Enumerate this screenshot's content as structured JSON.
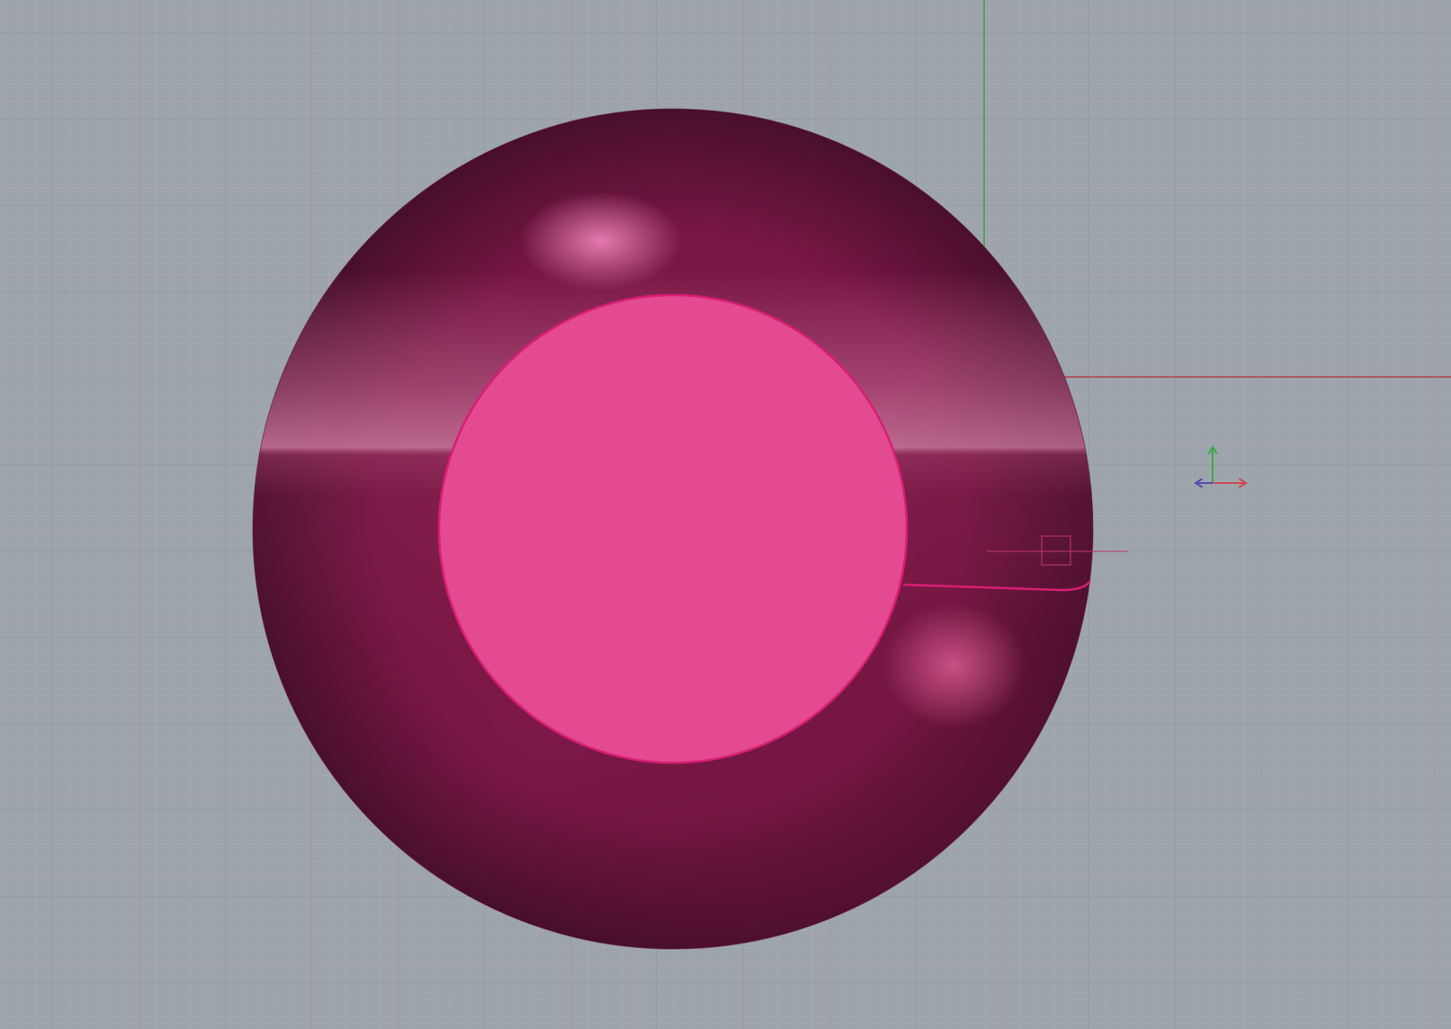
{
  "viewport": {
    "background_color": "#9ea4ac",
    "grid_minor_color": "#a7adb4",
    "grid_major_color": "#8f959d",
    "world_x_axis_color": "#b4434a",
    "world_y_axis_color": "#3f9a42"
  },
  "objects": {
    "outer_shell": {
      "kind": "sphere",
      "state": "selected",
      "colors": {
        "rim_dark": "#4a0f2c",
        "body": "#8a1a4e",
        "equator_light": "#c0668f",
        "highlight": "#ea7fb3"
      }
    },
    "inner_disc": {
      "kind": "circle-face",
      "state": "selected",
      "fill_color": "#e34a92",
      "edge_color": "#d81e73"
    },
    "seam_curve": {
      "kind": "curve",
      "state": "selected",
      "color": "#d81e73"
    }
  },
  "gumball": {
    "x_axis_color": "#c94a50",
    "y_axis_color": "#3fa84a",
    "z_axis_color": "#4c4fb0"
  }
}
